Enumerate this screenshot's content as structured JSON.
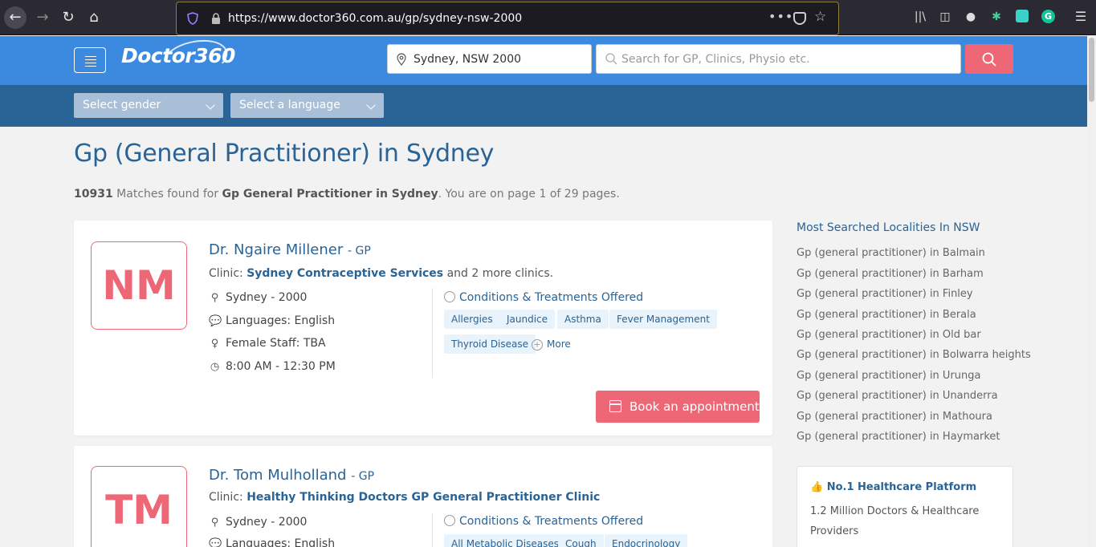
{
  "browser": {
    "url": "https://www.doctor360.com.au/gp/sydney-nsw-2000"
  },
  "header": {
    "logo_text": "Doctor360",
    "location_value": "Sydney, NSW 2000",
    "search_placeholder": "Search for GP, Clinics, Physio etc."
  },
  "filters": {
    "gender": "Select gender",
    "language": "Select a language"
  },
  "main": {
    "title": "Gp (General Practitioner) in Sydney",
    "matches_count": "10931",
    "matches_text": " Matches found for ",
    "matches_query": "Gp General Practitioner in Sydney",
    "matches_suffix": ". You are on page 1 of 29 pages."
  },
  "doctors": [
    {
      "initials": "NM",
      "name": "Dr. Ngaire Millener",
      "role": " - GP",
      "clinic_prefix": "Clinic: ",
      "clinic": "Sydney Contraceptive Services",
      "clinic_suffix": " and 2 more clinics.",
      "location": "Sydney - 2000",
      "languages": "Languages: English",
      "female_staff": "Female Staff: TBA",
      "hours": "8:00 AM - 12:30 PM",
      "conditions_heading": "Conditions & Treatments Offered",
      "tags": [
        "Allergies",
        "Jaundice",
        "Asthma",
        "Fever Management",
        "Thyroid Disease"
      ],
      "more": "More",
      "book": "Book an appointment"
    },
    {
      "initials": "TM",
      "name": "Dr. Tom Mulholland",
      "role": " - GP",
      "clinic_prefix": "Clinic: ",
      "clinic": "Healthy Thinking Doctors GP General Practitioner Clinic",
      "location": "Sydney - 2000",
      "languages": "Languages: English",
      "conditions_heading": "Conditions & Treatments Offered",
      "tags": [
        "All Metabolic Diseases",
        "Cough",
        "Endocrinology"
      ]
    }
  ],
  "sidebar": {
    "title": "Most Searched Localities In NSW",
    "links": [
      "Gp (general practitioner) in Balmain",
      "Gp (general practitioner) in Barham",
      "Gp (general practitioner) in Finley",
      "Gp (general practitioner) in Berala",
      "Gp (general practitioner) in Old bar",
      "Gp (general practitioner) in Bolwarra heights",
      "Gp (general practitioner) in Urunga",
      "Gp (general practitioner) in Unanderra",
      "Gp (general practitioner) in Mathoura",
      "Gp (general practitioner) in Haymarket"
    ],
    "platform_heading": "No.1 Healthcare Platform",
    "platform_body": "1.2 Million Doctors & Healthcare Providers"
  }
}
